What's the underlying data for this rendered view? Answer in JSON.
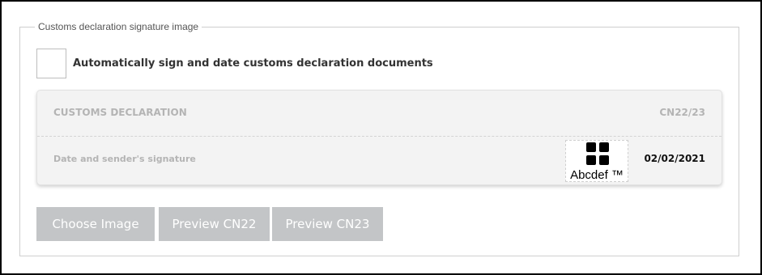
{
  "section": {
    "legend": "Customs declaration signature image",
    "auto_sign": {
      "label": "Automatically sign and date customs declaration documents",
      "checked": false
    }
  },
  "preview_card": {
    "title": "CUSTOMS DECLARATION",
    "code": "CN22/23",
    "signature_label": "Date and sender's signature",
    "signature_text": "Abcdef ™",
    "signature_icon": "grid-icon",
    "date": "02/02/2021"
  },
  "buttons": {
    "choose_image": "Choose Image",
    "preview_cn22": "Preview CN22",
    "preview_cn23": "Preview CN23"
  },
  "colors": {
    "button_bg": "#c3c5c7",
    "card_bg": "#f3f3f3",
    "muted_text": "#b4b4b4"
  }
}
